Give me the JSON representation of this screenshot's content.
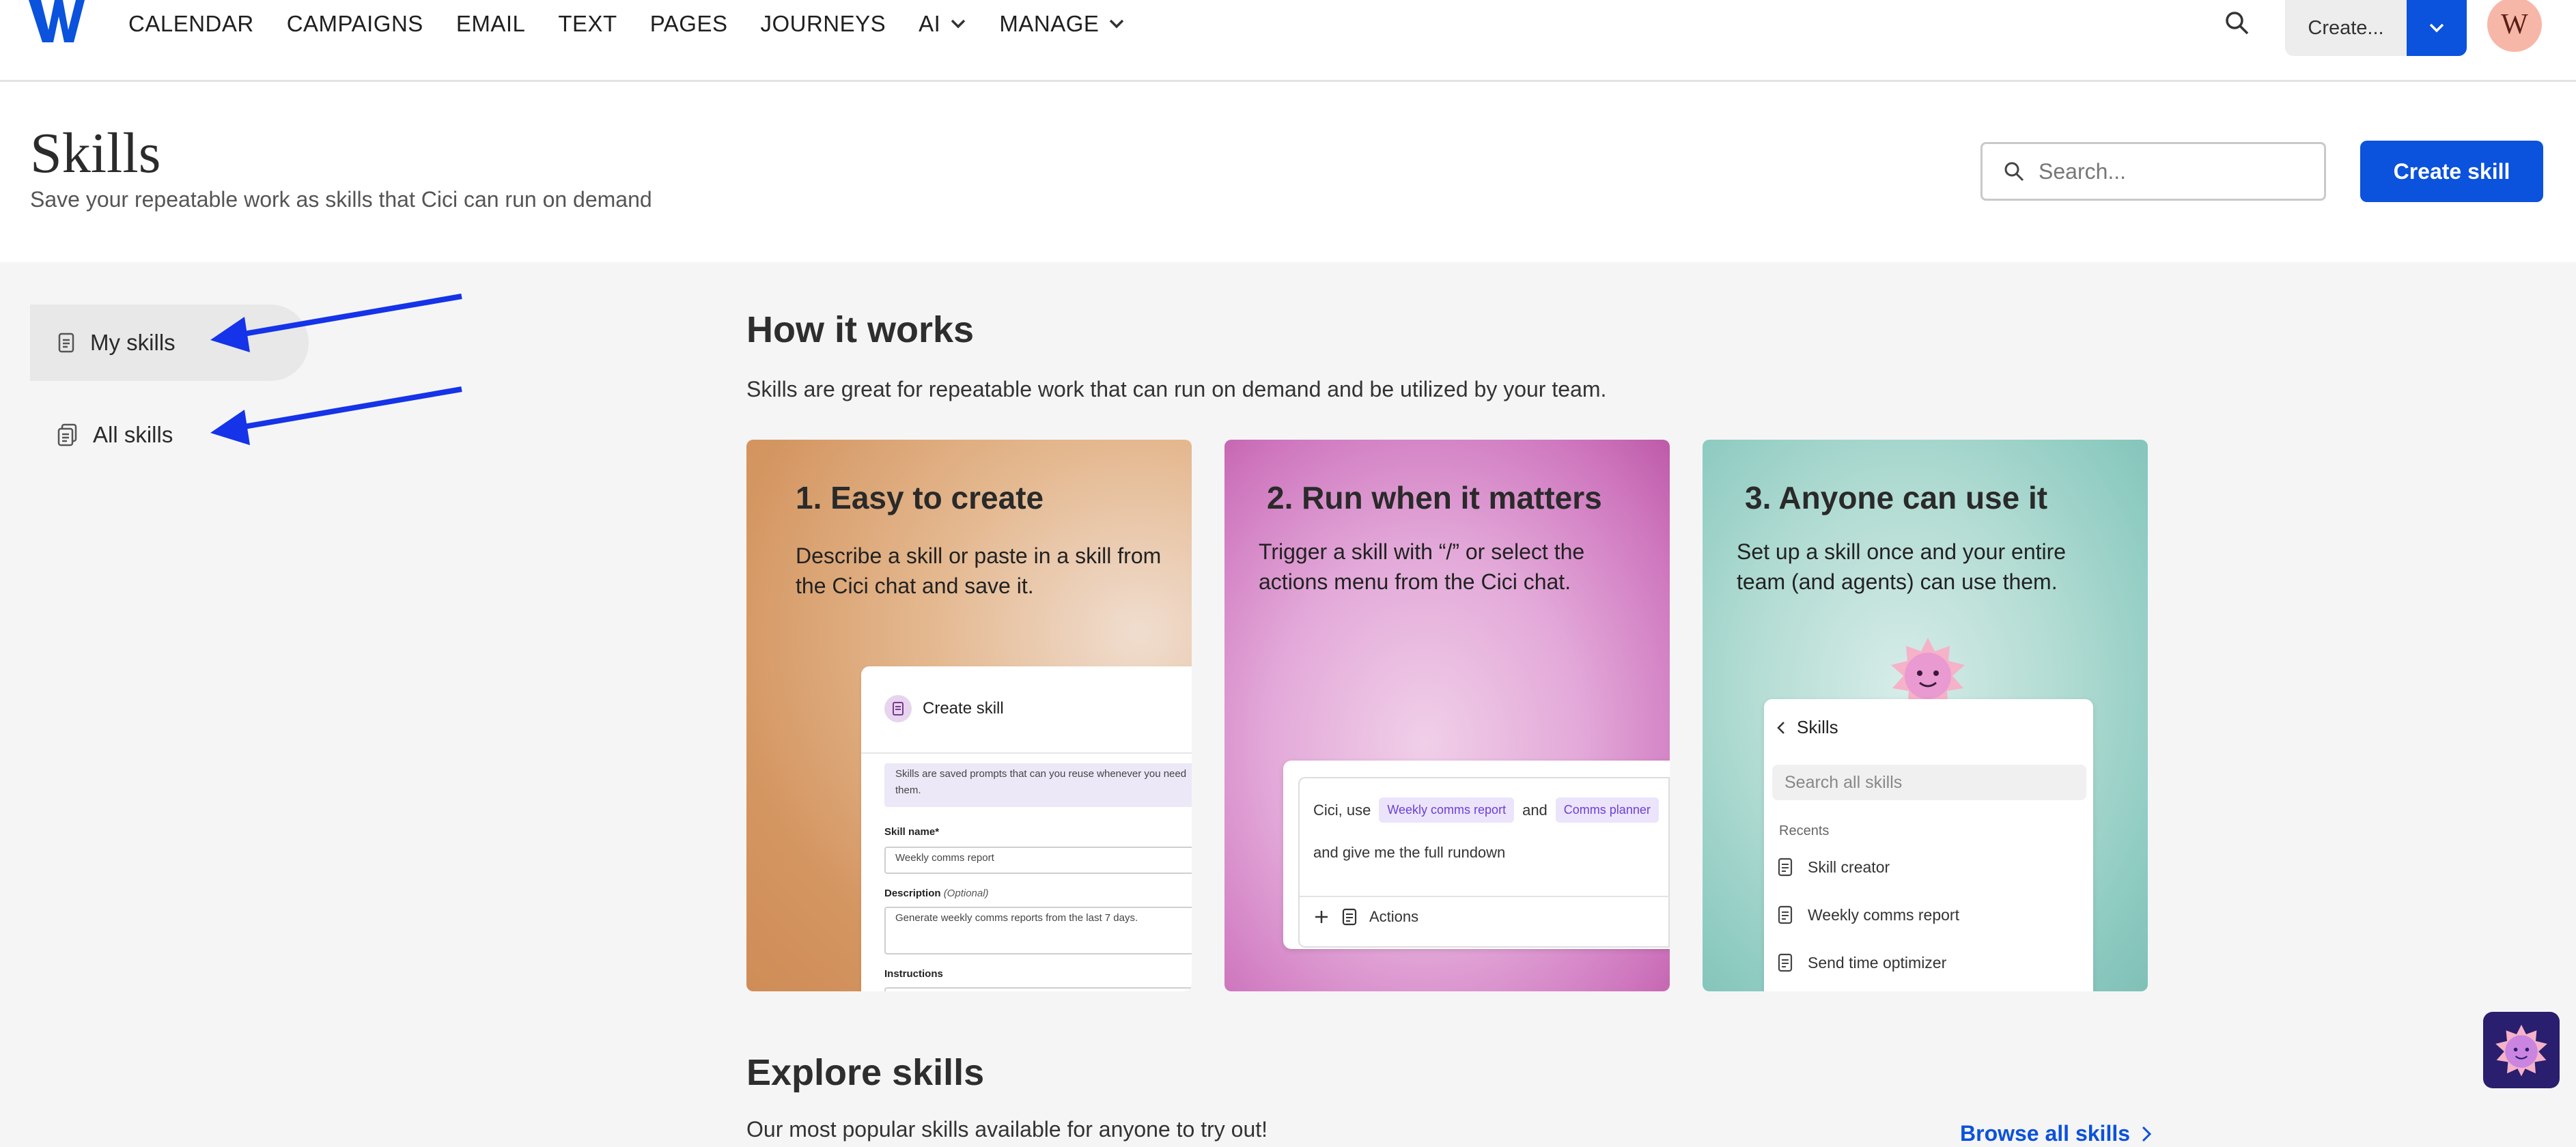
{
  "nav": {
    "items": [
      {
        "label": "CALENDAR"
      },
      {
        "label": "CAMPAIGNS"
      },
      {
        "label": "EMAIL"
      },
      {
        "label": "TEXT"
      },
      {
        "label": "PAGES"
      },
      {
        "label": "JOURNEYS"
      },
      {
        "label": "AI",
        "dropdown": true
      },
      {
        "label": "MANAGE",
        "dropdown": true
      }
    ],
    "create_label": "Create...",
    "avatar_initial": "W",
    "brand_color": "#0b52dc"
  },
  "header": {
    "title": "Skills",
    "subtitle": "Save your repeatable work as skills that Cici can run on demand",
    "search_placeholder": "Search...",
    "create_button": "Create skill"
  },
  "sidebar": {
    "items": [
      {
        "label": "My skills",
        "active": true
      },
      {
        "label": "All skills",
        "active": false
      }
    ]
  },
  "how_it_works": {
    "title": "How it works",
    "description": "Skills are great for repeatable work that can run on demand and be utilized by your team.",
    "cards": [
      {
        "title": "1. Easy to create",
        "text": "Describe a skill or paste in a skill from the Cici chat and save it.",
        "mock": {
          "header": "Create skill",
          "note": "Skills are saved prompts that can you reuse whenever you need them.",
          "skill_name_label": "Skill name*",
          "skill_name_value": "Weekly comms report",
          "description_label": "Description",
          "description_optional": "(Optional)",
          "description_value": "Generate weekly comms reports from the last 7 days.",
          "instructions_label": "Instructions"
        }
      },
      {
        "title": "2. Run when it matters",
        "text": "Trigger a skill with “/” or select the actions menu from the Cici chat.",
        "mock": {
          "prefix": "Cici, use",
          "chip1": "Weekly comms report",
          "connector": "and",
          "chip2": "Comms planner",
          "line2": "and give me the full rundown",
          "actions": "Actions"
        }
      },
      {
        "title": "3. Anyone can use it",
        "text": "Set up a skill once and your entire team (and agents) can use them.",
        "mock": {
          "header": "Skills",
          "search_placeholder": "Search all skills",
          "recents_label": "Recents",
          "recents": [
            "Skill creator",
            "Weekly comms report",
            "Send time optimizer"
          ]
        }
      }
    ]
  },
  "explore": {
    "title": "Explore skills",
    "description": "Our most popular skills available for anyone to try out!",
    "browse_link": "Browse all skills"
  }
}
